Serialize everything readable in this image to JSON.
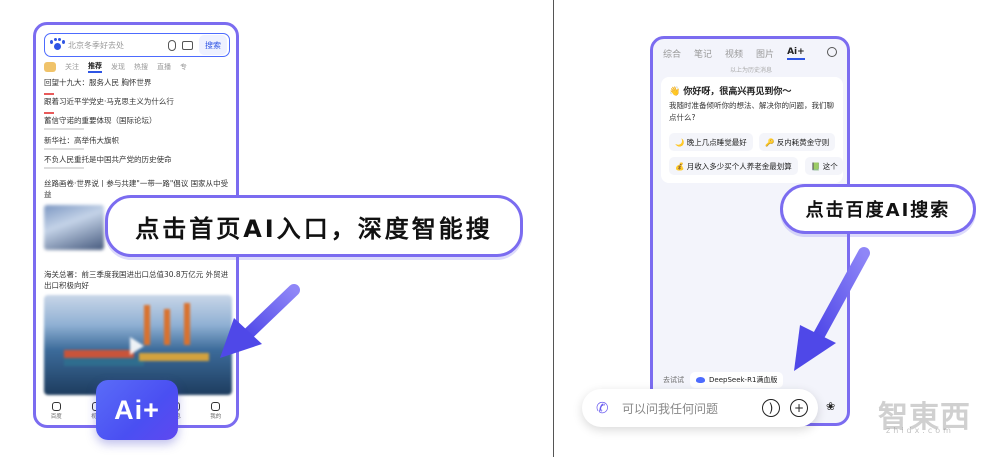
{
  "left_phone": {
    "search_placeholder": "北京冬季好去处",
    "search_button": "搜索",
    "tabs": [
      "关注",
      "推荐",
      "发现",
      "热搜",
      "直播",
      "专"
    ],
    "active_tab": "推荐",
    "news": [
      "回望十九大：服务人民 胸怀世界",
      "跟着习近平学党史·马克思主义为什么行",
      "蓄信守诺的重要体现（国际论坛）",
      "新华社：高举伟大旗帜",
      "不负人民重托是中国共产党的历史使命",
      "丝路画卷·世界说丨参与共建\"一带一路\"倡议 国家从中受益",
      "海关总署：前三季度我国进出口总值30.8万亿元 外贸进出口积极向好"
    ],
    "nav": [
      "百度",
      "视频",
      "",
      "消息",
      "我的"
    ]
  },
  "ai_button": {
    "label": "Ai+"
  },
  "callouts": {
    "left": "点击首页AI入口，深度智能搜",
    "right": "点击百度AI搜索"
  },
  "right_phone": {
    "tabs": [
      "综合",
      "笔记",
      "视频",
      "图片",
      "Ai+"
    ],
    "active_tab": "Ai+",
    "history_note": "以上为历史消息",
    "greeting": "👋 你好呀，很高兴再见到你～",
    "greeting_sub": "我随时准备倾听你的想法、解决你的问题，我们聊点什么?",
    "chips": [
      "🌙 晚上几点睡觉最好",
      "🔑 反内耗黄金守则",
      "💰 月收入多少买个人养老金最划算",
      "📗 这个"
    ],
    "try_label": "去试试",
    "deepseek_label": "DeepSeek-R1满血版"
  },
  "input_bar": {
    "placeholder": "可以问我任何问题"
  },
  "watermark": {
    "brand": "智東西",
    "sub": "zhidx.com"
  }
}
